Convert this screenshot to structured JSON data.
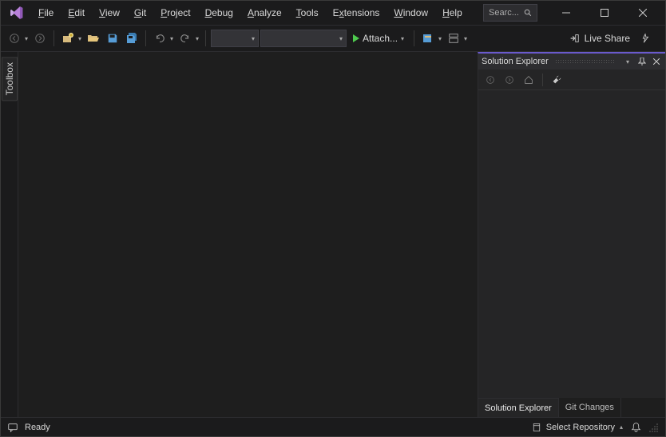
{
  "titlebar": {
    "menu": [
      {
        "label": "File",
        "accel": "F"
      },
      {
        "label": "Edit",
        "accel": "E"
      },
      {
        "label": "View",
        "accel": "V"
      },
      {
        "label": "Git",
        "accel": "G"
      },
      {
        "label": "Project",
        "accel": "P"
      },
      {
        "label": "Debug",
        "accel": "D"
      },
      {
        "label": "Analyze",
        "accel": "A"
      },
      {
        "label": "Tools",
        "accel": "T"
      },
      {
        "label": "Extensions",
        "accel": "E"
      },
      {
        "label": "Window",
        "accel": "W"
      },
      {
        "label": "Help",
        "accel": "H"
      }
    ],
    "search_placeholder": "Searc..."
  },
  "toolbar": {
    "attach_label": "Attach...",
    "live_share_label": "Live Share"
  },
  "left_rail": {
    "toolbox_label": "Toolbox"
  },
  "solution_explorer": {
    "title": "Solution Explorer",
    "tabs": {
      "active": "Solution Explorer",
      "inactive": "Git Changes"
    }
  },
  "statusbar": {
    "ready": "Ready",
    "select_repo": "Select Repository"
  }
}
